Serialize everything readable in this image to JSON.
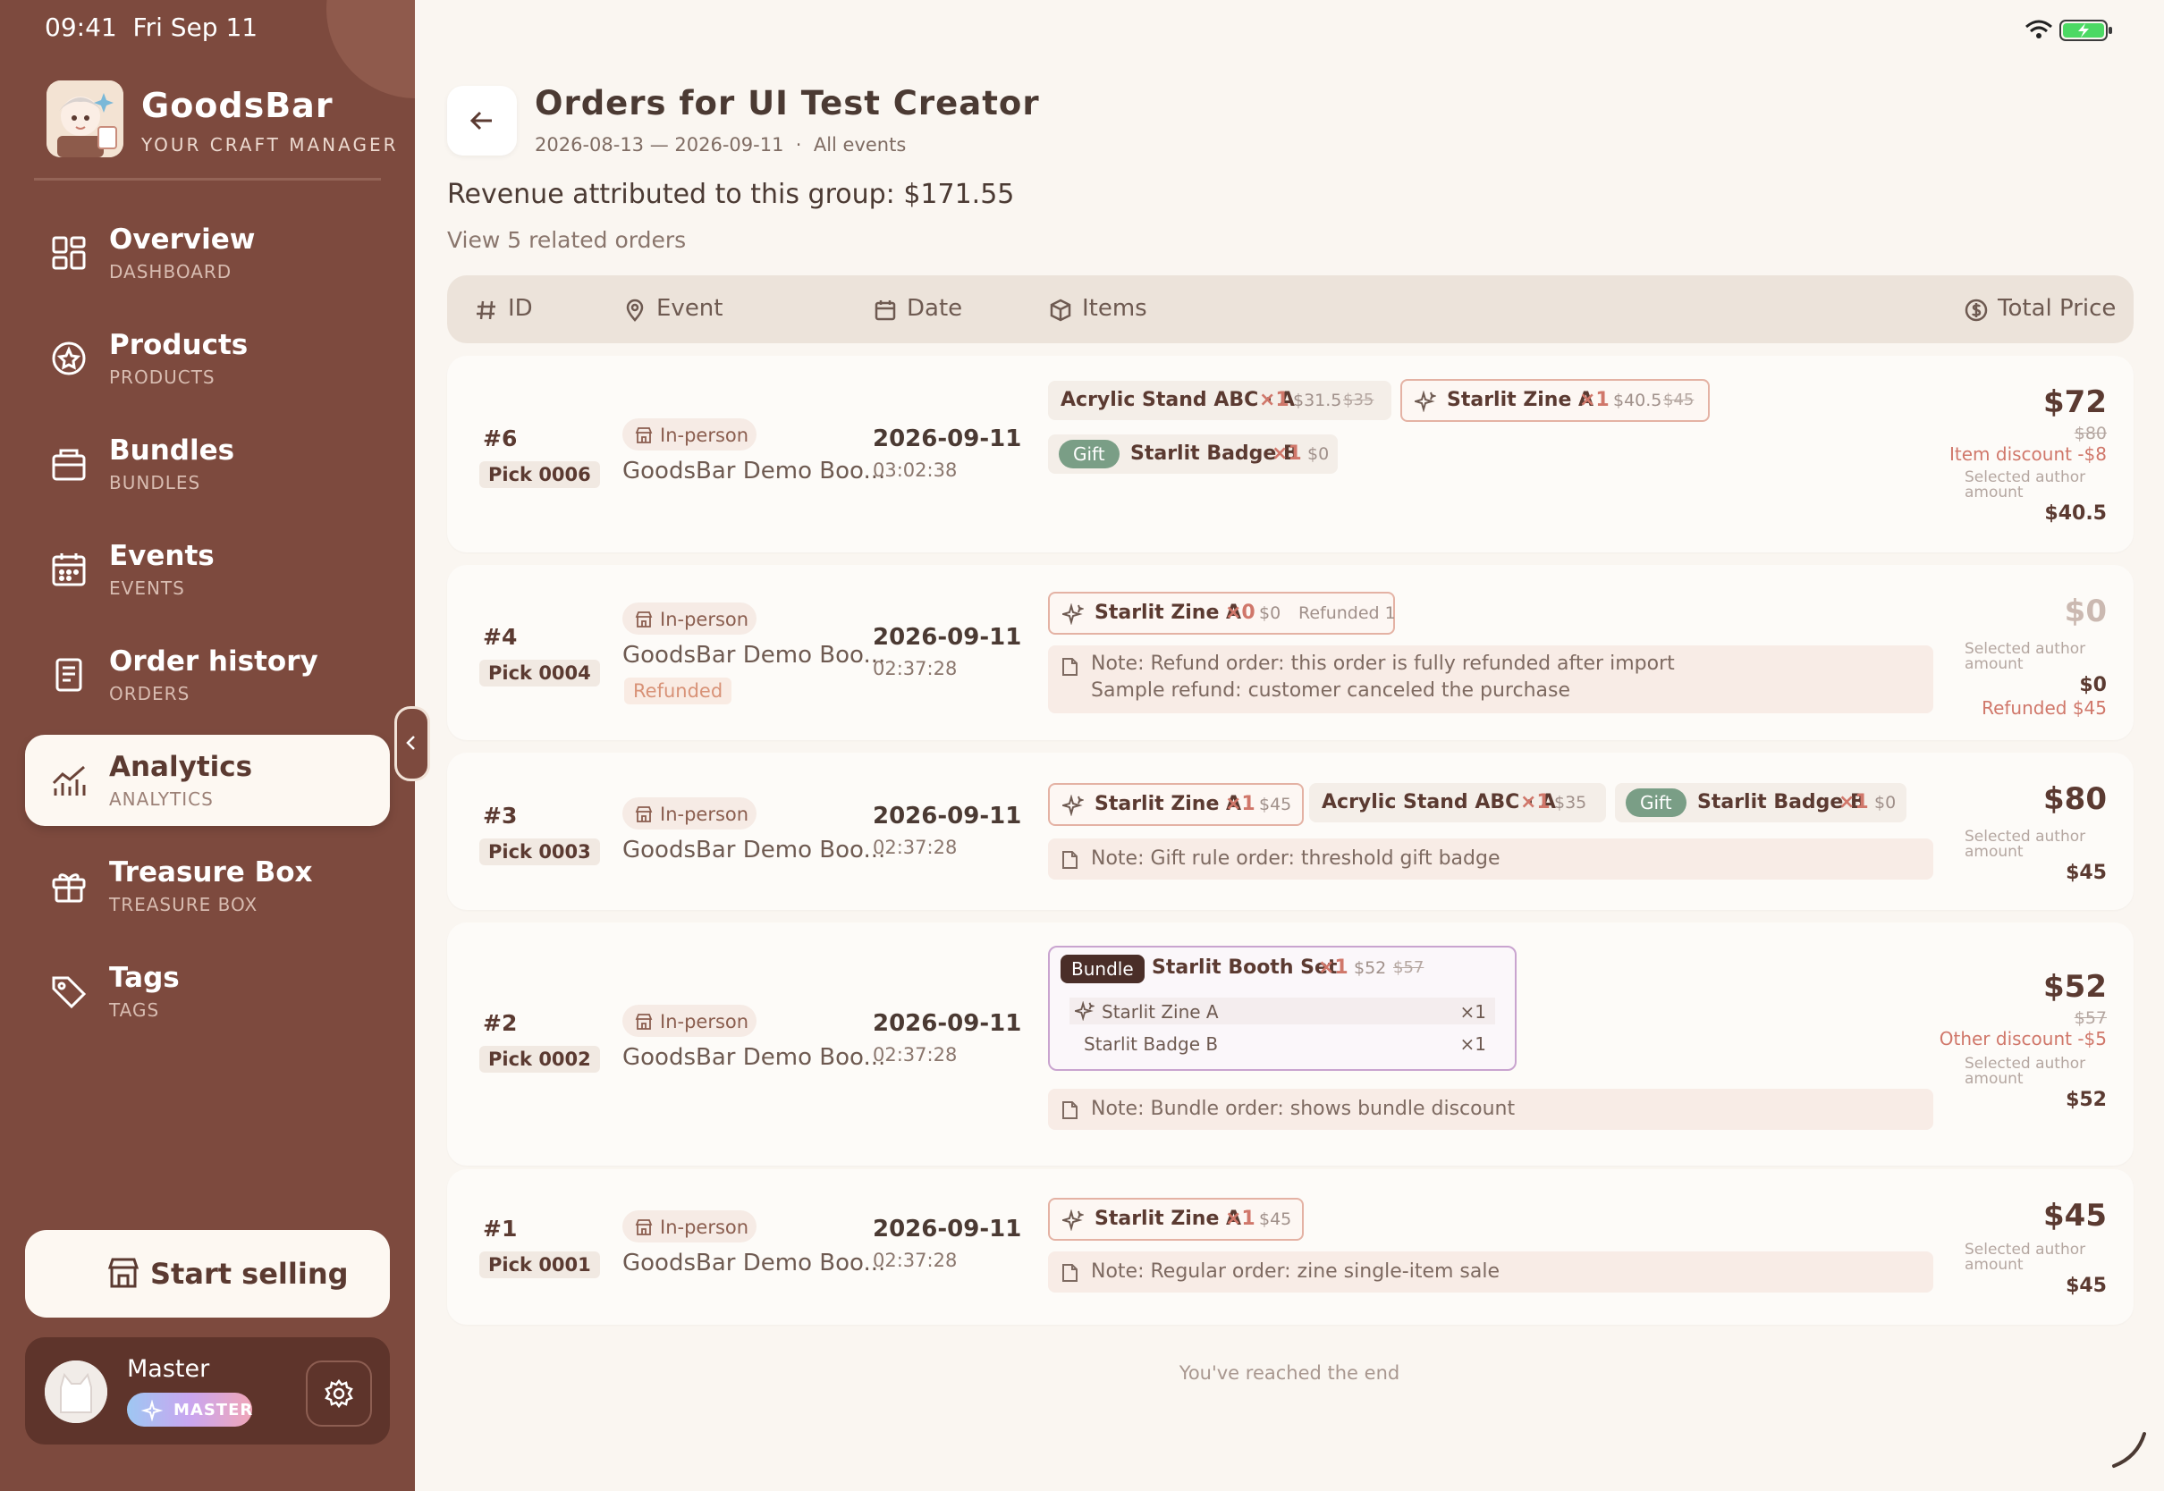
{
  "status": {
    "time": "09:41",
    "date": "Fri Sep 11"
  },
  "brand": {
    "name": "GoodsBar",
    "tagline": "YOUR CRAFT MANAGER"
  },
  "nav": [
    {
      "label": "Overview",
      "sub": "DASHBOARD",
      "icon": "dashboard-grid-icon"
    },
    {
      "label": "Products",
      "sub": "PRODUCTS",
      "icon": "product-star-icon"
    },
    {
      "label": "Bundles",
      "sub": "BUNDLES",
      "icon": "bundle-box-icon"
    },
    {
      "label": "Events",
      "sub": "EVENTS",
      "icon": "calendar-icon"
    },
    {
      "label": "Order history",
      "sub": "ORDERS",
      "icon": "receipt-icon"
    },
    {
      "label": "Analytics",
      "sub": "ANALYTICS",
      "icon": "chart-icon",
      "active": true
    },
    {
      "label": "Treasure Box",
      "sub": "TREASURE BOX",
      "icon": "gift-icon"
    },
    {
      "label": "Tags",
      "sub": "TAGS",
      "icon": "tag-icon"
    }
  ],
  "start_selling": "Start selling",
  "user": {
    "name": "Master",
    "badge": "MASTER"
  },
  "page": {
    "title": "Orders for UI Test Creator",
    "range": "2026-08-13 — 2026-09-11",
    "scope": "All events",
    "revenue": "Revenue attributed to this group: $171.55",
    "related": "View 5 related orders",
    "end": "You've reached the end"
  },
  "columns": {
    "id": "ID",
    "event": "Event",
    "date": "Date",
    "items": "Items",
    "total": "Total Price"
  },
  "colors": {
    "sidebar": "#7d4a3e",
    "accent": "#d0776a",
    "gift": "#7a9e86",
    "page_bg": "#faf6f1"
  },
  "common": {
    "in_person": "In-person",
    "event_name": "GoodsBar Demo Boo...",
    "selected_author_1": "Selected author",
    "selected_author_2": "amount",
    "gift": "Gift",
    "bundle": "Bundle"
  },
  "orders": [
    {
      "id": "#6",
      "pick": "Pick 0006",
      "date": "2026-09-11",
      "time": "03:02:38",
      "items": [
        {
          "name": "Acrylic Stand ABC · A",
          "qty": "×1",
          "price": "$31.5",
          "orig": "$35"
        },
        {
          "name": "Starlit Zine A",
          "qty": "×1",
          "price": "$40.5",
          "orig": "$45"
        },
        {
          "name": "Starlit Badge B",
          "qty": "×1",
          "price": "$0"
        }
      ],
      "total": "$72",
      "orig_total": "$80",
      "discount": "Item discount  -$8",
      "author_amount": "$40.5"
    },
    {
      "id": "#4",
      "pick": "Pick 0004",
      "date": "2026-09-11",
      "time": "02:37:28",
      "status": "Refunded",
      "items": [
        {
          "name": "Starlit Zine A",
          "qty": "×0",
          "price": "$0",
          "refund": "Refunded 1"
        }
      ],
      "note_1": "Note: Refund order: this order is fully refunded after import",
      "note_2": "Sample refund: customer canceled the purchase",
      "total": "$0",
      "author_amount": "$0",
      "refunded": "Refunded $45"
    },
    {
      "id": "#3",
      "pick": "Pick 0003",
      "date": "2026-09-11",
      "time": "02:37:28",
      "items": [
        {
          "name": "Starlit Zine A",
          "qty": "×1",
          "price": "$45"
        },
        {
          "name": "Acrylic Stand ABC · A",
          "qty": "×1",
          "price": "$35"
        },
        {
          "name": "Starlit Badge B",
          "qty": "×1",
          "price": "$0"
        }
      ],
      "note_1": "Note: Gift rule order: threshold gift badge",
      "total": "$80",
      "author_amount": "$45"
    },
    {
      "id": "#2",
      "pick": "Pick 0002",
      "date": "2026-09-11",
      "time": "02:37:28",
      "bundle": {
        "name": "Starlit Booth Set",
        "qty": "×1",
        "price": "$52",
        "orig": "$57",
        "children": [
          {
            "name": "Starlit Zine A",
            "qty": "×1"
          },
          {
            "name": "Starlit Badge B",
            "qty": "×1"
          }
        ]
      },
      "note_1": "Note: Bundle order: shows bundle discount",
      "total": "$52",
      "orig_total": "$57",
      "discount": "Other discount  -$5",
      "author_amount": "$52"
    },
    {
      "id": "#1",
      "pick": "Pick 0001",
      "date": "2026-09-11",
      "time": "02:37:28",
      "items": [
        {
          "name": "Starlit Zine A",
          "qty": "×1",
          "price": "$45"
        }
      ],
      "note_1": "Note: Regular order: zine single-item sale",
      "total": "$45",
      "author_amount": "$45"
    }
  ]
}
